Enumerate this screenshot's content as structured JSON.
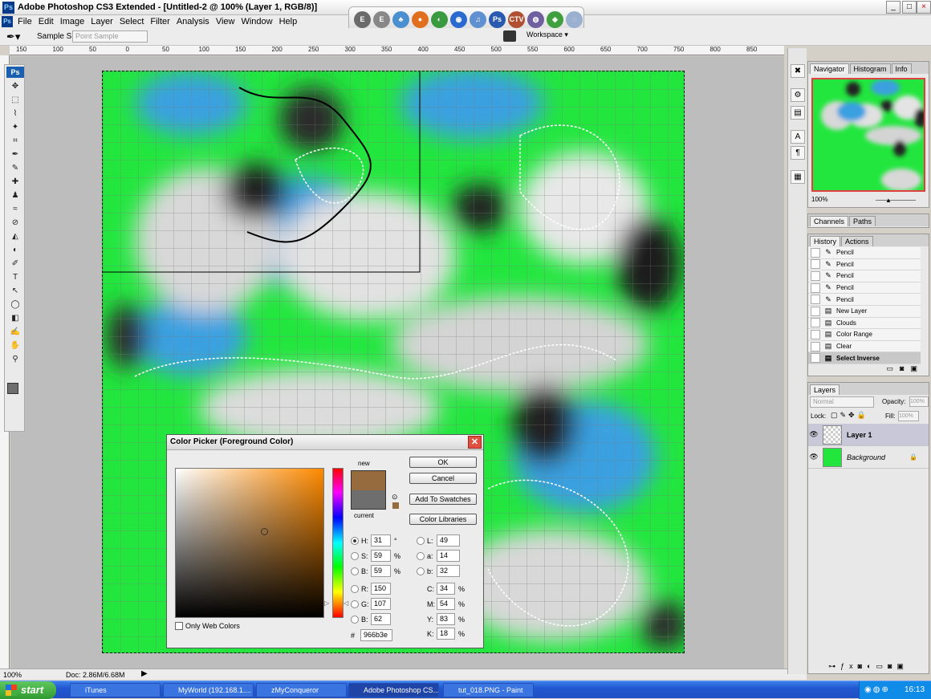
{
  "window": {
    "title": "Adobe Photoshop CS3 Extended - [Untitled-2 @ 100% (Layer 1, RGB/8)]",
    "app_icon": "Ps",
    "min": "_",
    "max": "□",
    "close": "×"
  },
  "menu": [
    "File",
    "Edit",
    "Image",
    "Layer",
    "Select",
    "Filter",
    "Analysis",
    "View",
    "Window",
    "Help"
  ],
  "quick_launch": [
    {
      "label": "E",
      "color": "#6a6a6a"
    },
    {
      "label": "E",
      "color": "#888888"
    },
    {
      "label": "♣",
      "color": "#4a90d0"
    },
    {
      "label": "●",
      "color": "#e07020"
    },
    {
      "label": "◐",
      "color": "#3a9a40"
    },
    {
      "label": "◉",
      "color": "#2a6ad0"
    },
    {
      "label": "♫",
      "color": "#6090d0"
    },
    {
      "label": "Ps",
      "color": "#2a5ab0"
    },
    {
      "label": "CTV",
      "color": "#b05030"
    },
    {
      "label": "◍",
      "color": "#7060a0"
    },
    {
      "label": "◈",
      "color": "#40a040"
    },
    {
      "label": "◌",
      "color": "#9ab0d0"
    }
  ],
  "options": {
    "sample_size_label": "Sample Size:",
    "sample_size_value": "Point Sample",
    "workspace": "Workspace ▾"
  },
  "ruler_ticks": [
    "150",
    "100",
    "50",
    "0",
    "50",
    "100",
    "150",
    "200",
    "250",
    "300",
    "350",
    "400",
    "450",
    "500",
    "550",
    "600",
    "650",
    "700",
    "750",
    "800",
    "850"
  ],
  "tools": [
    "✥",
    "⬚",
    "⌇",
    "✦",
    "⌗",
    "✒",
    "✎",
    "✚",
    "♟",
    "≈",
    "⊘",
    "◭",
    "◐",
    "✐",
    "T",
    "↖",
    "◯",
    "◧",
    "✍",
    "✋",
    "⚲"
  ],
  "status": {
    "zoom": "100%",
    "doc": "Doc: 2.86M/6.68M"
  },
  "dock_icons": [
    "✖",
    "⚙",
    "▤",
    "A",
    "¶",
    "▦"
  ],
  "navigator": {
    "tabs": [
      "Navigator",
      "Histogram",
      "Info"
    ],
    "zoom": "100%"
  },
  "channels": {
    "tabs": [
      "Channels",
      "Paths"
    ]
  },
  "history": {
    "tabs": [
      "History",
      "Actions"
    ],
    "items": [
      "Pencil",
      "Pencil",
      "Pencil",
      "Pencil",
      "Pencil",
      "New Layer",
      "Clouds",
      "Color Range",
      "Clear",
      "Select Inverse"
    ]
  },
  "layers": {
    "tab": "Layers",
    "blend": "Normal",
    "opacity_label": "Opacity:",
    "opacity": "100%",
    "lock_label": "Lock:",
    "fill_label": "Fill:",
    "fill": "100%",
    "items": [
      "Layer 1",
      "Background"
    ]
  },
  "dialog": {
    "title": "Color Picker (Foreground Color)",
    "new_label": "new",
    "current_label": "current",
    "new_color": "#966b3e",
    "current_color": "#6e6e6e",
    "buttons": [
      "OK",
      "Cancel",
      "Add To Swatches",
      "Color Libraries"
    ],
    "fields": {
      "H": "31",
      "S": "59",
      "B": "59",
      "R": "150",
      "G": "107",
      "Bb": "62",
      "L": "49",
      "a": "14",
      "b": "32",
      "C": "34",
      "M": "54",
      "Y": "83",
      "K": "18"
    },
    "units": {
      "deg": "°",
      "pct": "%"
    },
    "only_web": "Only Web Colors",
    "hex_label": "#",
    "hex": "966b3e"
  },
  "taskbar": {
    "start": "start",
    "tasks": [
      "iTunes",
      "MyWorld (192.168.1....",
      "zMyConqueror",
      "Adobe Photoshop CS...",
      "tut_018.PNG - Paint"
    ],
    "time": "16:13"
  }
}
